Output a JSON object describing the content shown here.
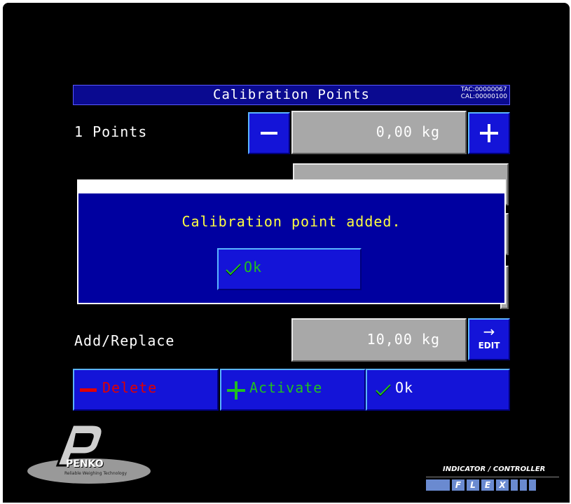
{
  "header": {
    "title": "Calibration Points",
    "tac": "TAC:00000067",
    "cal": "CAL:00000100"
  },
  "rows": {
    "points_label": "1 Points",
    "points_value": "0,00 kg",
    "add_replace_label": "Add/Replace",
    "add_replace_value": "10,00 kg",
    "edit_label": "EDIT"
  },
  "bottom_buttons": {
    "delete": "Delete",
    "activate": "Activate",
    "ok": "Ok"
  },
  "dialog": {
    "message": "Calibration point added.",
    "ok": "Ok"
  },
  "branding": {
    "logo": "PENKO",
    "logo_sub": "Reliable Weighing Technology",
    "product_line": "INDICATOR / CONTROLLER",
    "product_letters": [
      "F",
      "L",
      "E",
      "X"
    ]
  },
  "colors": {
    "button_blue": "#1414d8",
    "panel_blue": "#0a0a90",
    "dialog_blue": "#0000a0",
    "field_gray": "#a8a8a8",
    "message_yellow": "#ffff40",
    "delete_red": "#e00000",
    "activate_green": "#20c020"
  }
}
